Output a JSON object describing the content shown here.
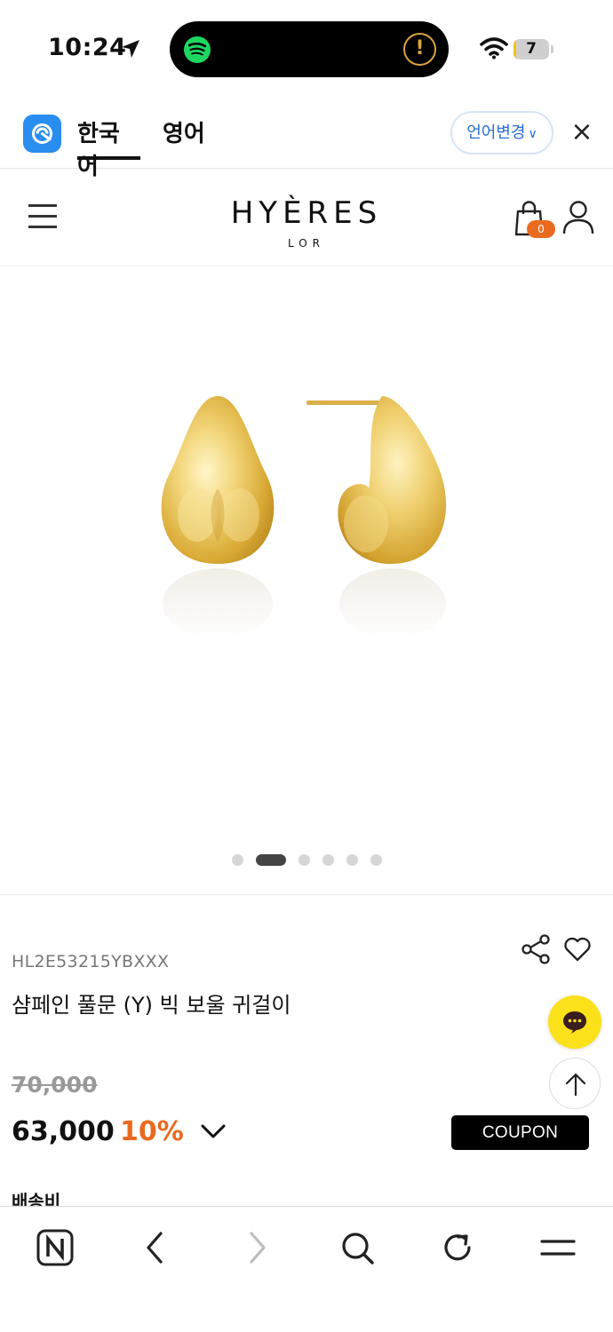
{
  "status_bar": {
    "time": "10:24",
    "battery_level": "7",
    "battery_fill_fraction": 0.07,
    "island_alert_symbol": "!",
    "icons": [
      "location-arrow-icon",
      "spotify-icon",
      "wifi-icon",
      "battery-icon"
    ]
  },
  "translate_bar": {
    "tab_active": "한국어",
    "tab_second": "영어",
    "change_button": "언어변경",
    "change_chevron": "∨",
    "close_symbol": "×",
    "accent_color": "#2a8ef0"
  },
  "header": {
    "logo_main": "HYÈRES",
    "logo_sub": "LOR",
    "cart_count": "0",
    "badge_color": "#ea6a1f"
  },
  "gallery": {
    "dot_count": 6,
    "active_dot_index": 1
  },
  "product": {
    "code": "HL2E53215YBXXX",
    "name": "샴페인 풀문 (Y) 빅 보울 귀걸이",
    "original_price": "70,000",
    "sale_price": "63,000",
    "discount": "10%",
    "coupon_label": "COUPON",
    "shipping_label": "배송비"
  },
  "bottom_nav": {
    "items": [
      "naver-home-icon",
      "back-icon",
      "forward-icon",
      "search-icon",
      "refresh-icon",
      "menu-icon"
    ]
  }
}
